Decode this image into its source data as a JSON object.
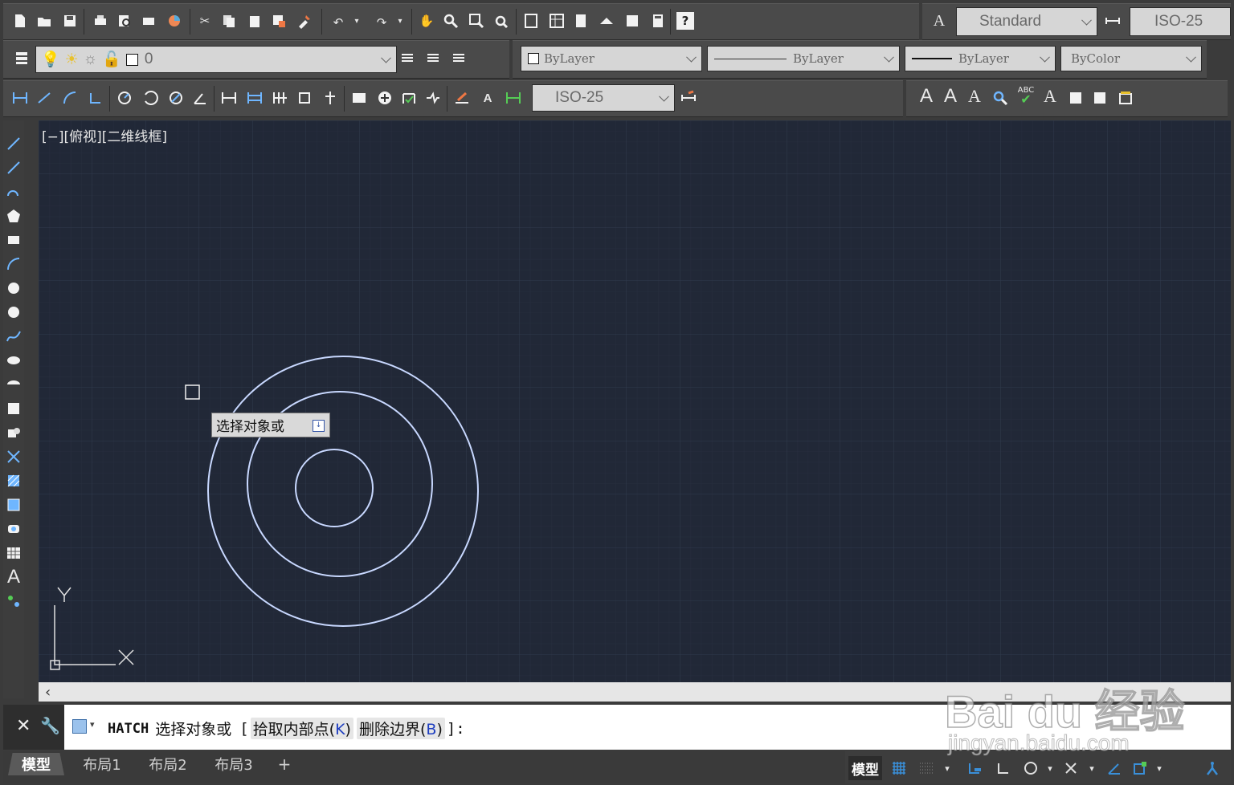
{
  "toolbar_top": {
    "text_style": "Standard",
    "dim_style": "ISO-25"
  },
  "layers": {
    "current_layer": "0",
    "color": "ByLayer",
    "linetype": "ByLayer",
    "lineweight": "ByLayer",
    "plotstyle": "ByColor"
  },
  "dim_toolbar": {
    "dim_style": "ISO-25"
  },
  "viewport": {
    "label": "[−][俯视][二维线框]",
    "axis_y": "Y",
    "axis_x": "X"
  },
  "tooltip": {
    "text": "选择对象或"
  },
  "command_line": {
    "command": "HATCH",
    "prompt": "选择对象或",
    "bracket_open": "[",
    "option1": "拾取内部点(",
    "option1_key": "K",
    "option1_close": ")",
    "option2": "删除边界(",
    "option2_key": "B",
    "option2_close": ")",
    "bracket_close": "]:"
  },
  "tabs": {
    "model": "模型",
    "layout1": "布局1",
    "layout2": "布局2",
    "layout3": "布局3",
    "add": "+"
  },
  "status": {
    "model": "模型"
  },
  "watermark": {
    "brand": "Bai du 经验",
    "url": "jingyan.baidu.com"
  },
  "colors": {
    "viewport_bg": "#212837",
    "circle": "#c8d8ff",
    "grid": "#2b3344",
    "accent": "#3a8fd8"
  },
  "icons": {
    "hscroll_left": "chevron-left-icon",
    "cmd_close": "close-icon",
    "cmd_settings": "wrench-icon"
  }
}
